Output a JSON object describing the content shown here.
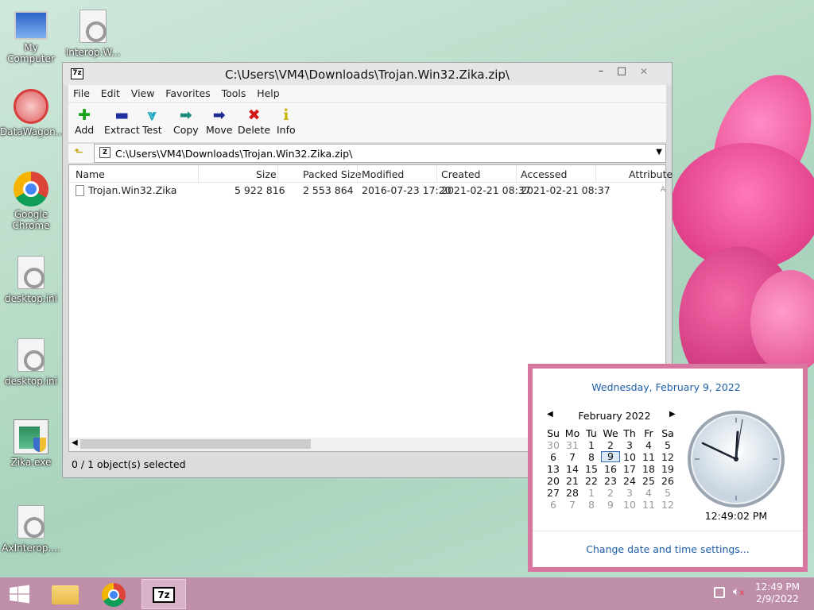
{
  "desktop": {
    "icons": [
      {
        "label": "My Computer",
        "icon": "computer-icon"
      },
      {
        "label": "Interop.W...",
        "icon": "file-icon"
      },
      {
        "label": "DataWagon...",
        "icon": "datawagon-icon"
      },
      {
        "label": "Google Chrome",
        "icon": "chrome-icon"
      },
      {
        "label": "desktop.ini",
        "icon": "file-icon"
      },
      {
        "label": "desktop.ini",
        "icon": "file-icon"
      },
      {
        "label": "Zika.exe",
        "icon": "exe-icon"
      },
      {
        "label": "AxInterop....",
        "icon": "file-icon"
      }
    ]
  },
  "window": {
    "app_icon": "7z",
    "title": "C:\\Users\\VM4\\Downloads\\Trojan.Win32.Zika.zip\\",
    "controls": {
      "minimize": "–",
      "maximize": "□",
      "close": "✕"
    },
    "menu": [
      "File",
      "Edit",
      "View",
      "Favorites",
      "Tools",
      "Help"
    ],
    "toolbar": [
      {
        "label": "Add",
        "icon": "add-icon",
        "glyph": "✚",
        "color": "#1aa21a"
      },
      {
        "label": "Extract",
        "icon": "extract-icon",
        "glyph": "▬",
        "color": "#1f2fa0"
      },
      {
        "label": "Test",
        "icon": "test-icon",
        "glyph": "⩔",
        "color": "#20a8c0"
      },
      {
        "label": "Copy",
        "icon": "copy-icon",
        "glyph": "➡",
        "color": "#1a8a7a"
      },
      {
        "label": "Move",
        "icon": "move-icon",
        "glyph": "➡",
        "color": "#1d2a90"
      },
      {
        "label": "Delete",
        "icon": "delete-icon",
        "glyph": "✖",
        "color": "#d01818"
      },
      {
        "label": "Info",
        "icon": "info-icon",
        "glyph": "i",
        "color": "#c8b400"
      }
    ],
    "address": "C:\\Users\\VM4\\Downloads\\Trojan.Win32.Zika.zip\\",
    "columns": [
      "Name",
      "Size",
      "Packed Size",
      "Modified",
      "Created",
      "Accessed",
      "Attribute"
    ],
    "rows": [
      {
        "name": "Trojan.Win32.Zika",
        "size": "5 922 816",
        "packed": "2 553 864",
        "modified": "2016-07-23 17:20",
        "created": "2021-02-21 08:37",
        "accessed": "2021-02-21 08:37",
        "attr": "A"
      }
    ],
    "status": "0 / 1 object(s) selected"
  },
  "calendar": {
    "long_date": "Wednesday, February 9, 2022",
    "month_title": "February 2022",
    "weekdays": [
      "Su",
      "Mo",
      "Tu",
      "We",
      "Th",
      "Fr",
      "Sa"
    ],
    "weeks": [
      [
        "30",
        "31",
        "1",
        "2",
        "3",
        "4",
        "5"
      ],
      [
        "6",
        "7",
        "8",
        "9",
        "10",
        "11",
        "12"
      ],
      [
        "13",
        "14",
        "15",
        "16",
        "17",
        "18",
        "19"
      ],
      [
        "20",
        "21",
        "22",
        "23",
        "24",
        "25",
        "26"
      ],
      [
        "27",
        "28",
        "1",
        "2",
        "3",
        "4",
        "5"
      ],
      [
        "6",
        "7",
        "8",
        "9",
        "10",
        "11",
        "12"
      ]
    ],
    "selected_day": "9",
    "time": "12:49:02 PM",
    "settings_link": "Change date and time settings..."
  },
  "taskbar": {
    "time": "12:49 PM",
    "date": "2/9/2022"
  }
}
